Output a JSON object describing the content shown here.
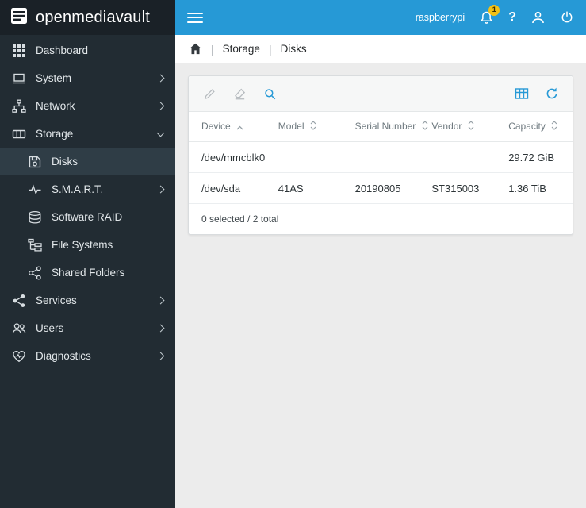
{
  "app": {
    "logo_title": "openmediavault"
  },
  "topbar": {
    "hostname": "raspberrypi",
    "notification_count": "1",
    "help_glyph": "?"
  },
  "breadcrumb": {
    "separator": "|",
    "items": [
      "Storage",
      "Disks"
    ]
  },
  "sidebar": {
    "items": [
      {
        "label": "Dashboard"
      },
      {
        "label": "System"
      },
      {
        "label": "Network"
      },
      {
        "label": "Storage"
      },
      {
        "label": "Disks"
      },
      {
        "label": "S.M.A.R.T."
      },
      {
        "label": "Software RAID"
      },
      {
        "label": "File Systems"
      },
      {
        "label": "Shared Folders"
      },
      {
        "label": "Services"
      },
      {
        "label": "Users"
      },
      {
        "label": "Diagnostics"
      }
    ]
  },
  "disks": {
    "columns": [
      "Device",
      "Model",
      "Serial Number",
      "Vendor",
      "Capacity"
    ],
    "rows": [
      {
        "device": "/dev/mmcblk0",
        "model": "",
        "serial": "",
        "vendor": "",
        "capacity": "29.72 GiB"
      },
      {
        "device": "/dev/sda",
        "model": "41AS",
        "serial": "20190805",
        "vendor": "ST315003",
        "capacity": "1.36 TiB"
      }
    ],
    "footer": "0 selected / 2 total"
  },
  "colors": {
    "accent": "#2699d6",
    "sidebar_bg": "#222c33",
    "badge_yellow": "#f2c115"
  }
}
